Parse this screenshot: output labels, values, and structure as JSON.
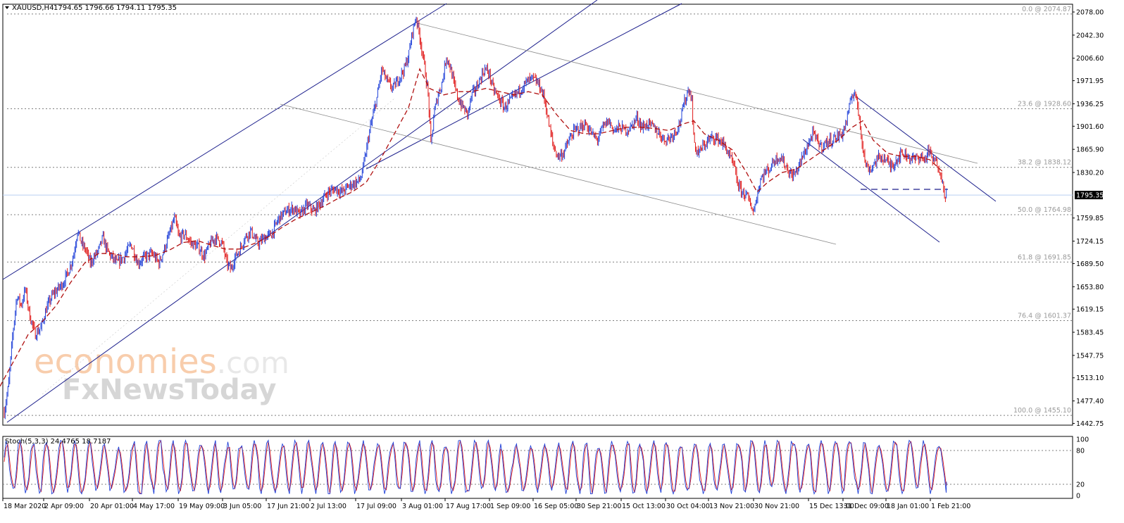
{
  "header": {
    "symbol": "XAUUSD,H4",
    "ohlc": "1794.65 1796.66 1794.11 1795.35"
  },
  "watermark": {
    "line1a": "economies",
    "line1b": ".com",
    "line2": "FxNewsToday"
  },
  "colors": {
    "bull": "#1e3fd8",
    "bear": "#e01818",
    "ma": "#b01010",
    "channel": "#1c1f8c",
    "grid": "#7f7f7f",
    "priceline": "#b8cff0"
  },
  "chart_data": [
    {
      "type": "candlestick",
      "title": "XAUUSD,H4",
      "ylim": [
        1440,
        2090
      ],
      "yticks": [
        "2078.00",
        "2042.30",
        "2006.60",
        "1971.95",
        "1936.25",
        "1901.60",
        "1865.90",
        "1830.20",
        "1795.35",
        "1759.85",
        "1724.15",
        "1689.50",
        "1653.80",
        "1619.15",
        "1583.45",
        "1547.75",
        "1513.10",
        "1477.40",
        "1442.75"
      ],
      "ytick_values": [
        2078.0,
        2042.3,
        2006.6,
        1971.95,
        1936.25,
        1901.6,
        1865.9,
        1830.2,
        1795.35,
        1759.85,
        1724.15,
        1689.5,
        1653.8,
        1619.15,
        1583.45,
        1547.75,
        1513.1,
        1477.4,
        1442.75
      ],
      "current_price": 1795.35,
      "current_price_label": "1795.35",
      "fib_levels": [
        {
          "label": "0.0 @ 2074.87",
          "value": 2074.87
        },
        {
          "label": "23.6 @ 1928.60",
          "value": 1928.6
        },
        {
          "label": "38.2 @ 1838.12",
          "value": 1838.12
        },
        {
          "label": "50.0 @ 1764.98",
          "value": 1764.98
        },
        {
          "label": "61.8 @ 1691.85",
          "value": 1691.85
        },
        {
          "label": "76.4 @ 1601.37",
          "value": 1601.37
        },
        {
          "label": "100.0 @ 1455.10",
          "value": 1455.1
        }
      ],
      "xticks": [
        "18 Mar 2020",
        "2 Apr 09:00",
        "20 Apr 01:00",
        "4 May 17:00",
        "19 May 09:00",
        "3 Jun 05:00",
        "17 Jun 21:00",
        "2 Jul 13:00",
        "17 Jul 09:00",
        "3 Aug 01:00",
        "17 Aug 17:00",
        "1 Sep 09:00",
        "16 Sep 05:00",
        "30 Sep 21:00",
        "15 Oct 13:00",
        "30 Oct 04:00",
        "13 Nov 21:00",
        "30 Nov 21:00",
        "15 Dec 13:00",
        "31 Dec 09:00",
        "18 Jan 01:00",
        "1 Feb 21:00"
      ],
      "price_path": [
        [
          0,
          1470
        ],
        [
          6,
          1460
        ],
        [
          12,
          1500
        ],
        [
          18,
          1580
        ],
        [
          24,
          1640
        ],
        [
          30,
          1625
        ],
        [
          36,
          1650
        ],
        [
          42,
          1610
        ],
        [
          50,
          1580
        ],
        [
          58,
          1590
        ],
        [
          66,
          1620
        ],
        [
          74,
          1640
        ],
        [
          82,
          1650
        ],
        [
          90,
          1660
        ],
        [
          98,
          1680
        ],
        [
          104,
          1700
        ],
        [
          110,
          1740
        ],
        [
          116,
          1720
        ],
        [
          122,
          1710
        ],
        [
          128,
          1690
        ],
        [
          134,
          1700
        ],
        [
          140,
          1710
        ],
        [
          146,
          1730
        ],
        [
          152,
          1710
        ],
        [
          158,
          1700
        ],
        [
          166,
          1690
        ],
        [
          176,
          1700
        ],
        [
          186,
          1720
        ],
        [
          196,
          1690
        ],
        [
          206,
          1700
        ],
        [
          216,
          1705
        ],
        [
          226,
          1690
        ],
        [
          236,
          1720
        ],
        [
          242,
          1740
        ],
        [
          248,
          1760
        ],
        [
          254,
          1730
        ],
        [
          262,
          1735
        ],
        [
          272,
          1720
        ],
        [
          282,
          1715
        ],
        [
          290,
          1700
        ],
        [
          298,
          1720
        ],
        [
          306,
          1730
        ],
        [
          316,
          1720
        ],
        [
          322,
          1690
        ],
        [
          328,
          1680
        ],
        [
          334,
          1700
        ],
        [
          340,
          1710
        ],
        [
          348,
          1730
        ],
        [
          356,
          1740
        ],
        [
          366,
          1720
        ],
        [
          376,
          1730
        ],
        [
          386,
          1735
        ],
        [
          396,
          1760
        ],
        [
          406,
          1770
        ],
        [
          416,
          1775
        ],
        [
          426,
          1765
        ],
        [
          436,
          1780
        ],
        [
          446,
          1770
        ],
        [
          456,
          1785
        ],
        [
          466,
          1800
        ],
        [
          476,
          1805
        ],
        [
          486,
          1800
        ],
        [
          496,
          1810
        ],
        [
          506,
          1815
        ],
        [
          512,
          1820
        ],
        [
          518,
          1850
        ],
        [
          524,
          1890
        ],
        [
          530,
          1920
        ],
        [
          536,
          1950
        ],
        [
          542,
          1990
        ],
        [
          550,
          1970
        ],
        [
          558,
          1960
        ],
        [
          566,
          1975
        ],
        [
          574,
          1990
        ],
        [
          580,
          2010
        ],
        [
          586,
          2050
        ],
        [
          591,
          2070
        ],
        [
          596,
          2040
        ],
        [
          602,
          2000
        ],
        [
          608,
          1950
        ],
        [
          612,
          1870
        ],
        [
          616,
          1920
        ],
        [
          622,
          1950
        ],
        [
          628,
          1970
        ],
        [
          634,
          2010
        ],
        [
          640,
          1990
        ],
        [
          646,
          1960
        ],
        [
          652,
          1940
        ],
        [
          658,
          1930
        ],
        [
          664,
          1920
        ],
        [
          670,
          1950
        ],
        [
          676,
          1960
        ],
        [
          682,
          1975
        ],
        [
          688,
          1990
        ],
        [
          694,
          1985
        ],
        [
          700,
          1960
        ],
        [
          708,
          1945
        ],
        [
          716,
          1930
        ],
        [
          724,
          1940
        ],
        [
          732,
          1950
        ],
        [
          740,
          1960
        ],
        [
          748,
          1970
        ],
        [
          756,
          1975
        ],
        [
          762,
          1970
        ],
        [
          768,
          1960
        ],
        [
          774,
          1940
        ],
        [
          780,
          1900
        ],
        [
          786,
          1870
        ],
        [
          792,
          1855
        ],
        [
          800,
          1860
        ],
        [
          808,
          1880
        ],
        [
          816,
          1895
        ],
        [
          824,
          1900
        ],
        [
          832,
          1905
        ],
        [
          840,
          1890
        ],
        [
          848,
          1880
        ],
        [
          856,
          1900
        ],
        [
          864,
          1910
        ],
        [
          872,
          1895
        ],
        [
          880,
          1900
        ],
        [
          888,
          1895
        ],
        [
          896,
          1900
        ],
        [
          904,
          1915
        ],
        [
          912,
          1900
        ],
        [
          920,
          1905
        ],
        [
          928,
          1900
        ],
        [
          936,
          1890
        ],
        [
          944,
          1880
        ],
        [
          952,
          1885
        ],
        [
          960,
          1895
        ],
        [
          966,
          1910
        ],
        [
          972,
          1940
        ],
        [
          978,
          1960
        ],
        [
          982,
          1945
        ],
        [
          986,
          1870
        ],
        [
          992,
          1860
        ],
        [
          998,
          1870
        ],
        [
          1006,
          1880
        ],
        [
          1014,
          1885
        ],
        [
          1022,
          1880
        ],
        [
          1030,
          1870
        ],
        [
          1036,
          1855
        ],
        [
          1042,
          1840
        ],
        [
          1048,
          1810
        ],
        [
          1054,
          1800
        ],
        [
          1060,
          1795
        ],
        [
          1066,
          1780
        ],
        [
          1070,
          1770
        ],
        [
          1074,
          1790
        ],
        [
          1080,
          1820
        ],
        [
          1086,
          1830
        ],
        [
          1092,
          1835
        ],
        [
          1100,
          1850
        ],
        [
          1108,
          1855
        ],
        [
          1116,
          1840
        ],
        [
          1124,
          1825
        ],
        [
          1130,
          1830
        ],
        [
          1136,
          1845
        ],
        [
          1142,
          1860
        ],
        [
          1148,
          1875
        ],
        [
          1154,
          1890
        ],
        [
          1160,
          1880
        ],
        [
          1166,
          1870
        ],
        [
          1172,
          1875
        ],
        [
          1180,
          1880
        ],
        [
          1188,
          1885
        ],
        [
          1196,
          1890
        ],
        [
          1202,
          1910
        ],
        [
          1206,
          1930
        ],
        [
          1210,
          1950
        ],
        [
          1214,
          1955
        ],
        [
          1218,
          1930
        ],
        [
          1222,
          1900
        ],
        [
          1226,
          1860
        ],
        [
          1230,
          1840
        ],
        [
          1236,
          1835
        ],
        [
          1242,
          1845
        ],
        [
          1250,
          1855
        ],
        [
          1258,
          1850
        ],
        [
          1264,
          1840
        ],
        [
          1270,
          1845
        ],
        [
          1276,
          1855
        ],
        [
          1282,
          1860
        ],
        [
          1290,
          1855
        ],
        [
          1298,
          1850
        ],
        [
          1306,
          1855
        ],
        [
          1314,
          1850
        ],
        [
          1318,
          1865
        ],
        [
          1324,
          1850
        ],
        [
          1330,
          1845
        ],
        [
          1336,
          1830
        ],
        [
          1340,
          1800
        ],
        [
          1344,
          1795
        ]
      ],
      "ma_path": [
        [
          0,
          1500
        ],
        [
          20,
          1540
        ],
        [
          40,
          1580
        ],
        [
          60,
          1600
        ],
        [
          80,
          1625
        ],
        [
          100,
          1660
        ],
        [
          120,
          1690
        ],
        [
          140,
          1705
        ],
        [
          160,
          1705
        ],
        [
          180,
          1700
        ],
        [
          200,
          1700
        ],
        [
          220,
          1702
        ],
        [
          240,
          1710
        ],
        [
          260,
          1722
        ],
        [
          280,
          1725
        ],
        [
          300,
          1718
        ],
        [
          320,
          1712
        ],
        [
          340,
          1712
        ],
        [
          360,
          1720
        ],
        [
          380,
          1730
        ],
        [
          400,
          1745
        ],
        [
          420,
          1758
        ],
        [
          440,
          1768
        ],
        [
          460,
          1778
        ],
        [
          480,
          1790
        ],
        [
          500,
          1800
        ],
        [
          520,
          1815
        ],
        [
          540,
          1850
        ],
        [
          560,
          1890
        ],
        [
          580,
          1930
        ],
        [
          596,
          1990
        ],
        [
          610,
          1960
        ],
        [
          630,
          1950
        ],
        [
          650,
          1955
        ],
        [
          670,
          1955
        ],
        [
          690,
          1960
        ],
        [
          710,
          1955
        ],
        [
          730,
          1950
        ],
        [
          750,
          1955
        ],
        [
          770,
          1950
        ],
        [
          790,
          1920
        ],
        [
          810,
          1895
        ],
        [
          830,
          1890
        ],
        [
          850,
          1890
        ],
        [
          870,
          1895
        ],
        [
          890,
          1900
        ],
        [
          910,
          1900
        ],
        [
          930,
          1898
        ],
        [
          950,
          1895
        ],
        [
          970,
          1905
        ],
        [
          985,
          1910
        ],
        [
          1000,
          1890
        ],
        [
          1020,
          1880
        ],
        [
          1040,
          1865
        ],
        [
          1060,
          1830
        ],
        [
          1075,
          1800
        ],
        [
          1090,
          1815
        ],
        [
          1110,
          1830
        ],
        [
          1130,
          1835
        ],
        [
          1150,
          1850
        ],
        [
          1170,
          1865
        ],
        [
          1190,
          1880
        ],
        [
          1210,
          1900
        ],
        [
          1225,
          1910
        ],
        [
          1240,
          1880
        ],
        [
          1260,
          1860
        ],
        [
          1280,
          1855
        ],
        [
          1300,
          1855
        ],
        [
          1320,
          1850
        ],
        [
          1340,
          1830
        ]
      ],
      "stochastic": {
        "label": "Stoch(5,3,3) 24.4765 18.7187",
        "ylim": [
          0,
          100
        ],
        "levels": [
          20,
          80
        ],
        "ytick_labels": [
          "100",
          "80",
          "20",
          "0"
        ],
        "ytick_values": [
          100,
          80,
          20,
          0
        ]
      }
    }
  ]
}
